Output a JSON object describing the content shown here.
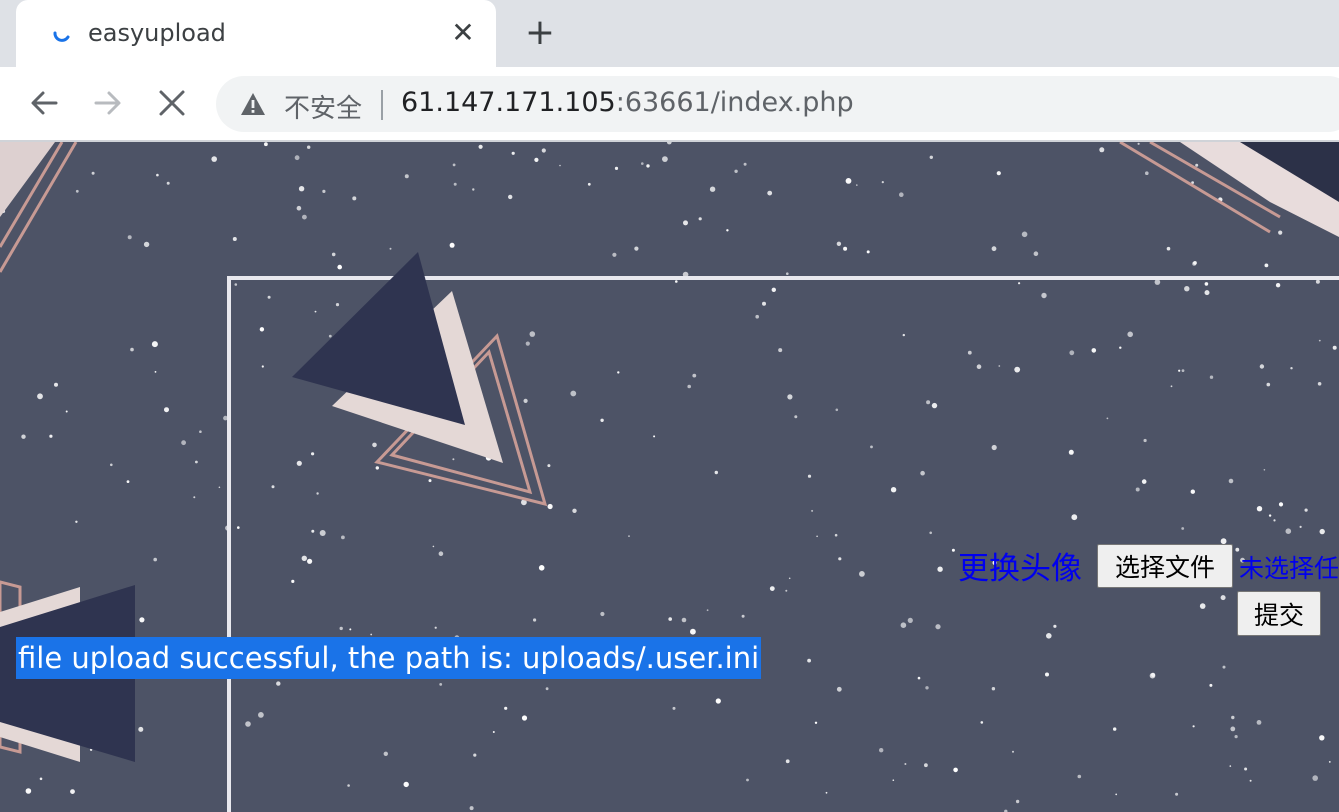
{
  "browser": {
    "tab": {
      "title": "easyupload",
      "close_glyph": "✕",
      "loading_icon": "spinner-icon"
    },
    "new_tab_glyph": "+",
    "nav": {
      "back_icon": "arrow-left-icon",
      "forward_icon": "arrow-right-icon",
      "stop_icon": "close-icon"
    },
    "omnibox": {
      "security_label": "不安全",
      "url_host": "61.147.171.105",
      "url_rest": ":63661/index.php"
    }
  },
  "page": {
    "background_color": "#4d5366",
    "upload_form": {
      "label": "更换头像",
      "choose_file_label": "选择文件",
      "no_file_text": "未选择任",
      "submit_label": "提交"
    },
    "result_message": "file upload successful, the path is: uploads/.user.ini"
  }
}
